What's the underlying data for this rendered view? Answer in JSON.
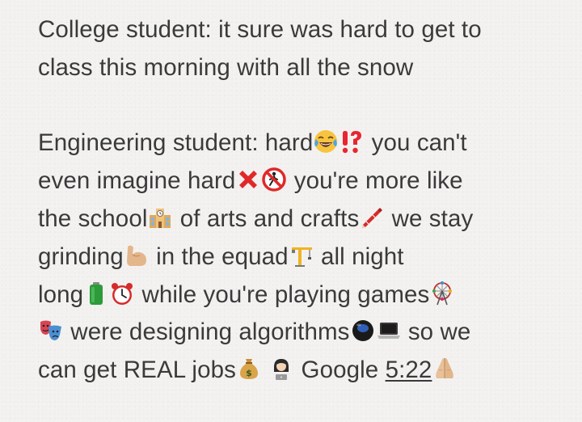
{
  "note": {
    "p1": {
      "l1": "College student: it sure was hard to get to",
      "l2": "class this morning with all the snow"
    },
    "p2": {
      "l1a": "Engineering student: hard",
      "l1b": "you can't",
      "l2a": "even imagine hard",
      "l2b": "you're more like",
      "l3a": "the school",
      "l3b": "of arts and crafts",
      "l3c": "we stay",
      "l4a": "grinding",
      "l4b": "in the equad",
      "l4c": "all night",
      "l5a": "long",
      "l5b": "while you're playing games",
      "l6a": "were designing algorithms",
      "l6b": "so we",
      "l7a": "can get REAL jobs",
      "l7b": "Google",
      "l7c": "5:22"
    }
  },
  "emoji": [
    "face-with-tears-of-joy-icon",
    "exclamation-question-icon",
    "cross-mark-icon",
    "no-pedestrians-icon",
    "school-icon",
    "crayon-icon",
    "flexed-biceps-icon",
    "crane-icon",
    "battery-icon",
    "alarm-clock-icon",
    "ferris-wheel-icon",
    "performing-arts-icon",
    "magic-8-ball-icon",
    "laptop-icon",
    "money-bag-icon",
    "technologist-icon",
    "folded-hands-icon"
  ]
}
